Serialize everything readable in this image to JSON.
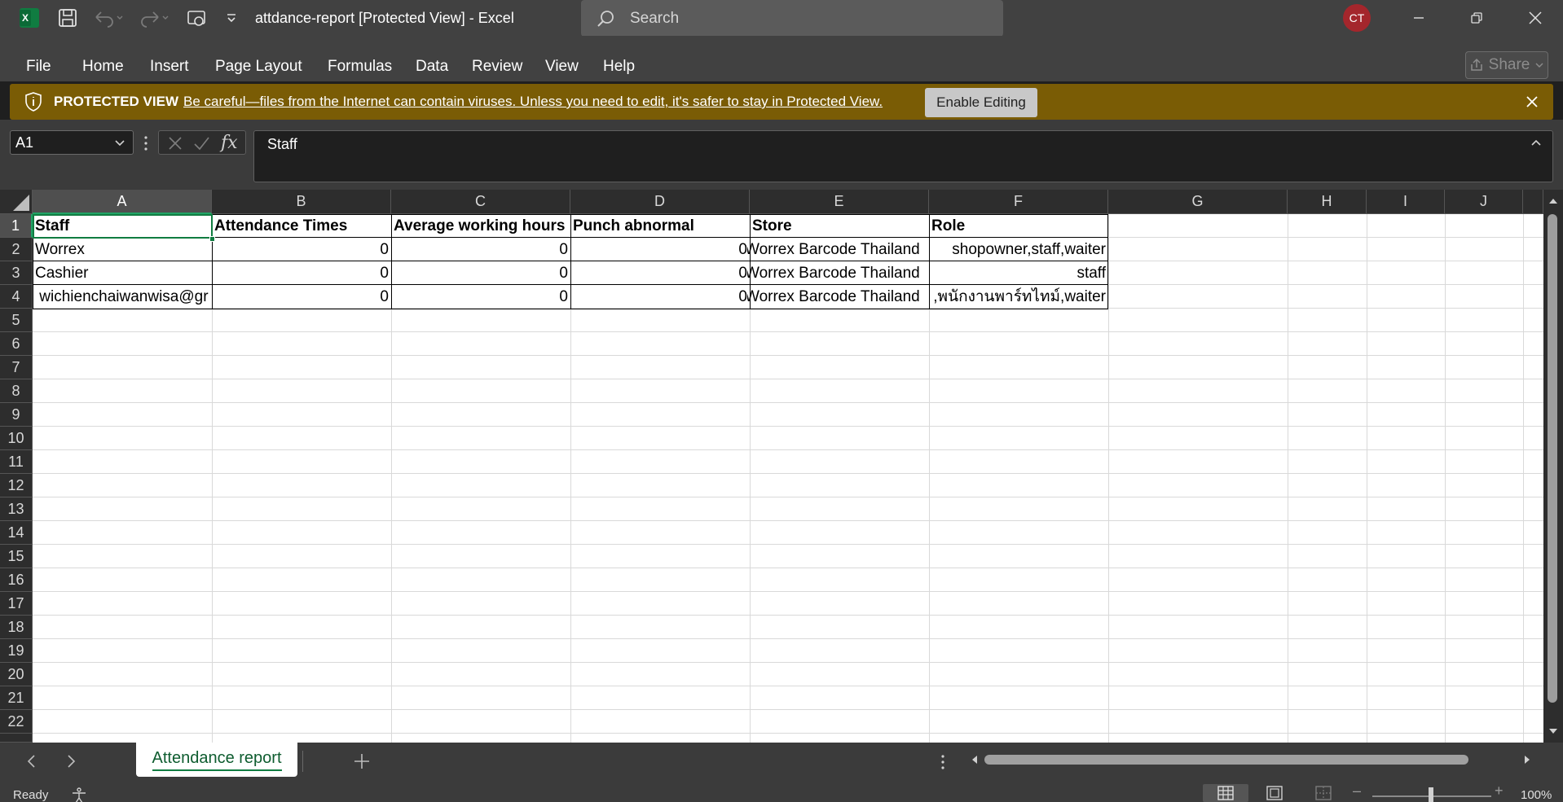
{
  "app": {
    "title": "attdance-report  [Protected View]  -  Excel",
    "user_initials": "CT"
  },
  "search": {
    "placeholder": "Search"
  },
  "menu": {
    "items": [
      "File",
      "Home",
      "Insert",
      "Page Layout",
      "Formulas",
      "Data",
      "Review",
      "View",
      "Help"
    ],
    "share_label": "Share"
  },
  "protected_view": {
    "label": "PROTECTED VIEW",
    "message": "Be careful—files from the Internet can contain viruses. Unless you need to edit, it's safer to stay in Protected View.",
    "enable_label": "Enable Editing"
  },
  "formula_bar": {
    "name_box": "A1",
    "fx_label": "fx",
    "content": "Staff"
  },
  "grid": {
    "columns": [
      "A",
      "B",
      "C",
      "D",
      "E",
      "F",
      "G",
      "H",
      "I",
      "J"
    ],
    "rows": [
      "1",
      "2",
      "3",
      "4",
      "5",
      "6",
      "7",
      "8",
      "9",
      "10",
      "11",
      "12",
      "13",
      "14",
      "15",
      "16",
      "17",
      "18",
      "19",
      "20",
      "21",
      "22"
    ],
    "cells": {
      "r1": [
        "Staff",
        "Attendance Times",
        "Average working hours",
        "Punch abnormal",
        "Store",
        "Role"
      ],
      "r2": [
        "Worrex",
        "0",
        "0",
        "0",
        "Worrex Barcode Thailand",
        "shopowner,staff,waiter"
      ],
      "r3": [
        "Cashier",
        "0",
        "0",
        "0",
        "Worrex Barcode Thailand",
        "staff"
      ],
      "r4": [
        " wichienchaiwanwisa@gr",
        "0",
        "0",
        "0",
        "Worrex Barcode Thailand",
        ",พนักงานพาร์ทไทม์,waiter"
      ]
    }
  },
  "sheet_tabs": {
    "active": "Attendance report"
  },
  "status": {
    "ready": "Ready",
    "zoom": "100%"
  },
  "colors": {
    "accent": "#107c41",
    "protected_bar": "#7a5c05",
    "avatar": "#a4262c"
  }
}
